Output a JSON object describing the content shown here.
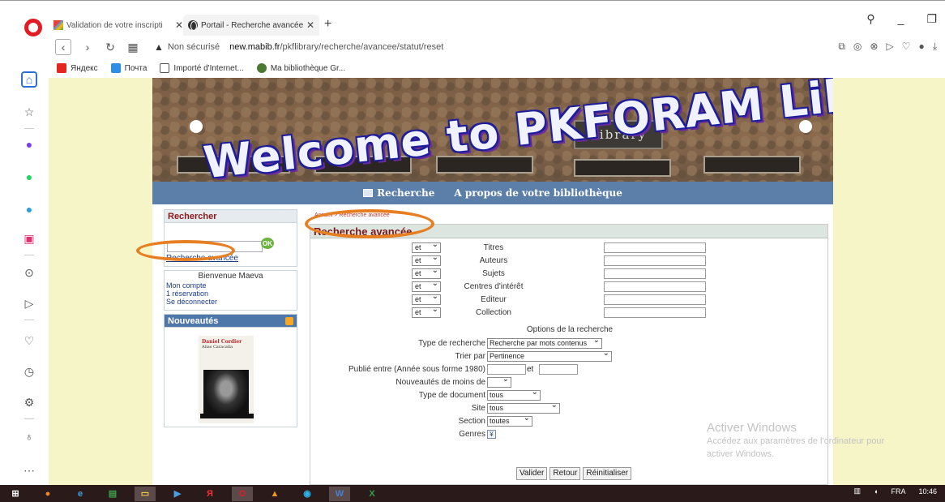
{
  "browser": {
    "tabs": [
      {
        "title": "Validation de votre inscripti",
        "icon": "gmail-icon"
      },
      {
        "title": "Portail - Recherche avancée",
        "icon": "globe-icon"
      }
    ],
    "address": {
      "security": "Non sécurisé",
      "url_prefix": "new.",
      "url_domain": "mabib.fr",
      "url_path": "/pkflibrary/recherche/avancee/statut/reset"
    },
    "bookmarks": [
      "Яндекс",
      "Почта",
      "Importé d'Internet...",
      "Ma bibliothèque Gr..."
    ],
    "sidebar_icons": [
      "home-icon",
      "star-icon",
      "messenger-icon",
      "whatsapp-icon",
      "telegram-icon",
      "instagram-icon",
      "player-icon",
      "send-icon",
      "heart-icon",
      "history-icon",
      "settings-icon",
      "bulb-icon",
      "more-icon"
    ]
  },
  "site": {
    "banner_title": "Welcome to PKFORAM Library Database",
    "banner_sign": "Library",
    "nav": [
      "Recherche",
      "A propos de votre bibliothèque"
    ]
  },
  "left": {
    "search_title": "Rechercher",
    "ok_label": "OK",
    "advanced_link": "Recherche avancée",
    "welcome": "Bienvenue Maeva",
    "account_links": [
      "Mon compte",
      "1 réservation",
      "Se déconnecter"
    ],
    "new_title": "Nouveautés",
    "book_author": "Daniel Cordier",
    "book_subtitle": "Alias Caracalla"
  },
  "main": {
    "breadcrumb": "Accueil > Recherche avancée",
    "title": "Recherche avancée",
    "criteria": [
      {
        "op": "et",
        "label": "Titres"
      },
      {
        "op": "et",
        "label": "Auteurs"
      },
      {
        "op": "et",
        "label": "Sujets"
      },
      {
        "op": "et",
        "label": "Centres d'intérêt"
      },
      {
        "op": "et",
        "label": "Editeur"
      },
      {
        "op": "et",
        "label": "Collection"
      }
    ],
    "options_title": "Options de la recherche",
    "options": {
      "search_type_label": "Type de recherche",
      "search_type_value": "Recherche par mots contenus",
      "sort_label": "Trier par",
      "sort_value": "Pertinence",
      "published_label": "Publié entre (Année sous forme 1980)",
      "published_and": "et",
      "new_label": "Nouveautés de moins de",
      "new_value": "",
      "doctype_label": "Type de document",
      "doctype_value": "tous",
      "site_label": "Site",
      "site_value": "tous",
      "section_label": "Section",
      "section_value": "toutes",
      "genres_label": "Genres"
    },
    "buttons": [
      "Valider",
      "Retour",
      "Réinitialiser"
    ]
  },
  "watermark": {
    "title": "Activer Windows",
    "line1": "Accédez aux paramètres de l'ordinateur pour",
    "line2": "activer Windows."
  },
  "taskbar": {
    "apps": [
      "start-icon",
      "firefox-icon",
      "ie-icon",
      "store-icon",
      "explorer-icon",
      "mediaplayer-icon",
      "yandex-icon",
      "opera-icon",
      "vlc-icon",
      "edge-icon",
      "word-icon",
      "excel-icon"
    ],
    "lang": "FRA",
    "time": "10:46"
  },
  "colors": {
    "nav_bar": "#5b7fa8",
    "annotation": "#e67e22",
    "panel_title": "#7a1616"
  }
}
